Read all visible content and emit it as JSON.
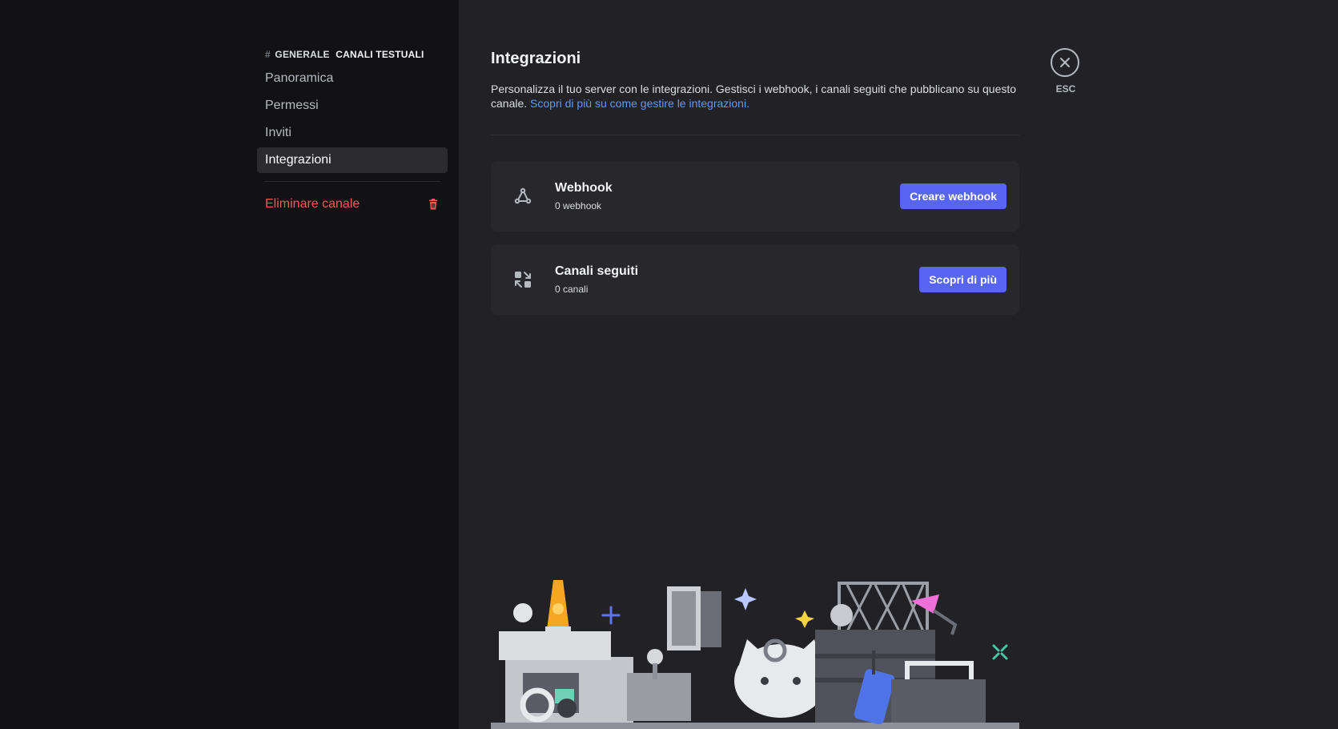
{
  "sidebar": {
    "header_hash": "#",
    "header_channel": "GENERALE",
    "header_category": "CANALI TESTUALI",
    "items": [
      {
        "label": "Panoramica"
      },
      {
        "label": "Permessi"
      },
      {
        "label": "Inviti"
      },
      {
        "label": "Integrazioni"
      }
    ],
    "delete_label": "Eliminare canale"
  },
  "main": {
    "title": "Integrazioni",
    "description": "Personalizza il tuo server con le integrazioni. Gestisci i webhook, i canali seguiti che pubblicano su questo canale.",
    "learn_more_link": "Scopri di più su come gestire le integrazioni.",
    "cards": [
      {
        "title": "Webhook",
        "subtitle": "0 webhook",
        "button": "Creare webhook",
        "icon": "webhook-icon"
      },
      {
        "title": "Canali seguiti",
        "subtitle": "0 canali",
        "button": "Scopri di più",
        "icon": "followed-channels-icon"
      }
    ]
  },
  "close": {
    "esc_label": "ESC",
    "icon": "close-icon"
  },
  "colors": {
    "accent": "#5865f2",
    "danger": "#f0595c",
    "link": "#5b9bf8",
    "sidebar_bg": "#121214",
    "content_bg": "#222226"
  }
}
